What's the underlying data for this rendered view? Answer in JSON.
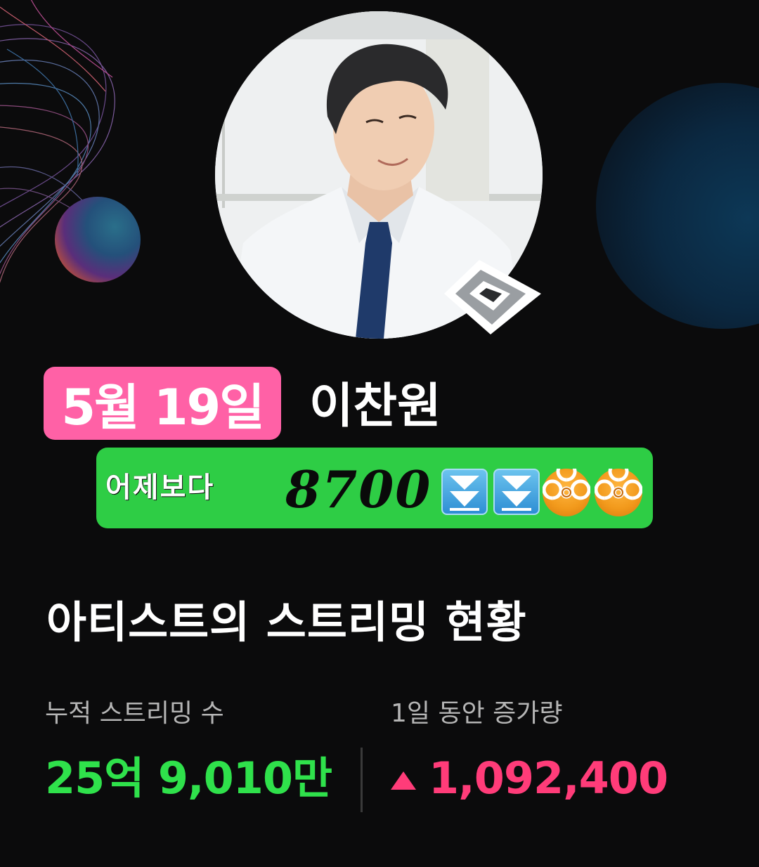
{
  "artist": {
    "date": "5월 19일",
    "name": "이찬원"
  },
  "compare": {
    "label": "어제보다",
    "value": "8700",
    "icons": [
      "double-down-arrow-icon",
      "double-down-arrow-icon",
      "biohazard-icon",
      "biohazard-icon"
    ]
  },
  "section": {
    "title": "아티스트의 스트리밍 현황"
  },
  "stats": {
    "total_label": "누적 스트리밍 수",
    "total_value": "25억 9,010만",
    "daily_label": "1일 동안 증가량",
    "daily_value": "1,092,400"
  },
  "colors": {
    "background": "#0b0b0c",
    "date_pill": "#ff61a6",
    "compare_bar": "#2ecd45",
    "total_green": "#2fe14b",
    "increase_pink": "#ff3c79"
  }
}
